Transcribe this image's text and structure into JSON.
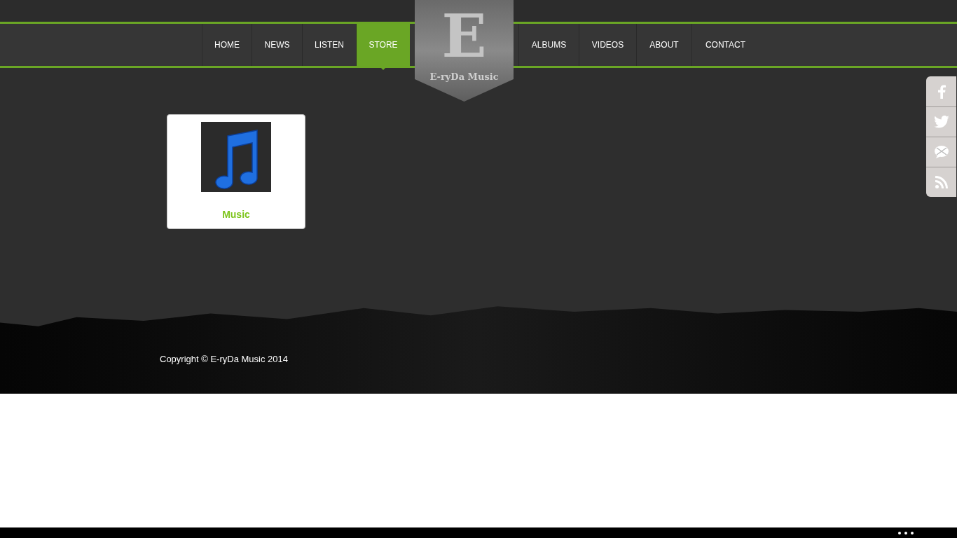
{
  "nav_left": [
    {
      "label": "HOME",
      "selected": false
    },
    {
      "label": "NEWS",
      "selected": false
    },
    {
      "label": "LISTEN",
      "selected": false
    },
    {
      "label": "STORE",
      "selected": true
    }
  ],
  "logo": {
    "letter": "E",
    "name": "E-ryDa Music"
  },
  "nav_right": [
    {
      "label": "ALBUMS",
      "selected": false
    },
    {
      "label": "VIDEOS",
      "selected": false
    },
    {
      "label": "ABOUT",
      "selected": false
    },
    {
      "label": "CONTACT",
      "selected": false
    }
  ],
  "store_items": [
    {
      "label": "Music"
    }
  ],
  "social": [
    {
      "kind": "facebook"
    },
    {
      "kind": "twitter"
    },
    {
      "kind": "email"
    },
    {
      "kind": "rss"
    }
  ],
  "footer": {
    "copyright": "Copyright © E-ryDa Music 2014"
  }
}
